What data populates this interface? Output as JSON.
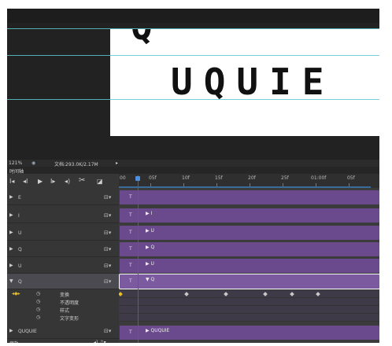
{
  "canvas": {
    "top_letter": "Q",
    "title_text": "UQUIE"
  },
  "statusbar": {
    "zoom": "121%",
    "doc_info": "文档:293.0K/2.17M",
    "arrow": "▸"
  },
  "timeline": {
    "tab_label": "时间轴",
    "transport": {
      "first": "I◂",
      "prev": "◂I",
      "play": "▶",
      "next": "I▸",
      "audio": "◂)",
      "split": "✂",
      "transition": "◪"
    },
    "ruler": {
      "labels": [
        "00",
        "05f",
        "10f",
        "15f",
        "20f",
        "25f",
        "01:00f",
        "05f"
      ]
    },
    "layers": [
      {
        "name": "E",
        "badge": "T",
        "track_label": "",
        "expanded": false
      },
      {
        "name": "I",
        "badge": "T",
        "track_label": "I",
        "expanded": false
      },
      {
        "name": "U",
        "badge": "T",
        "track_label": "U",
        "expanded": false
      },
      {
        "name": "Q",
        "badge": "T",
        "track_label": "Q",
        "expanded": false
      },
      {
        "name": "U",
        "badge": "T",
        "track_label": "U",
        "expanded": false
      },
      {
        "name": "Q",
        "badge": "T",
        "track_label": "Q",
        "expanded": true
      }
    ],
    "properties": [
      {
        "name": "变换"
      },
      {
        "name": "不透明度"
      },
      {
        "name": "样式"
      },
      {
        "name": "文字变形"
      }
    ],
    "group_layer": {
      "name": "QUQUIE",
      "badge": "T",
      "track_label": "QUQUIE"
    },
    "audio_track": {
      "name": "音轨"
    },
    "colors": {
      "track": "#6a4a8c",
      "track_selected": "#7b5aa0",
      "playhead": "#d03030",
      "guide": "#5ac8d0"
    }
  }
}
